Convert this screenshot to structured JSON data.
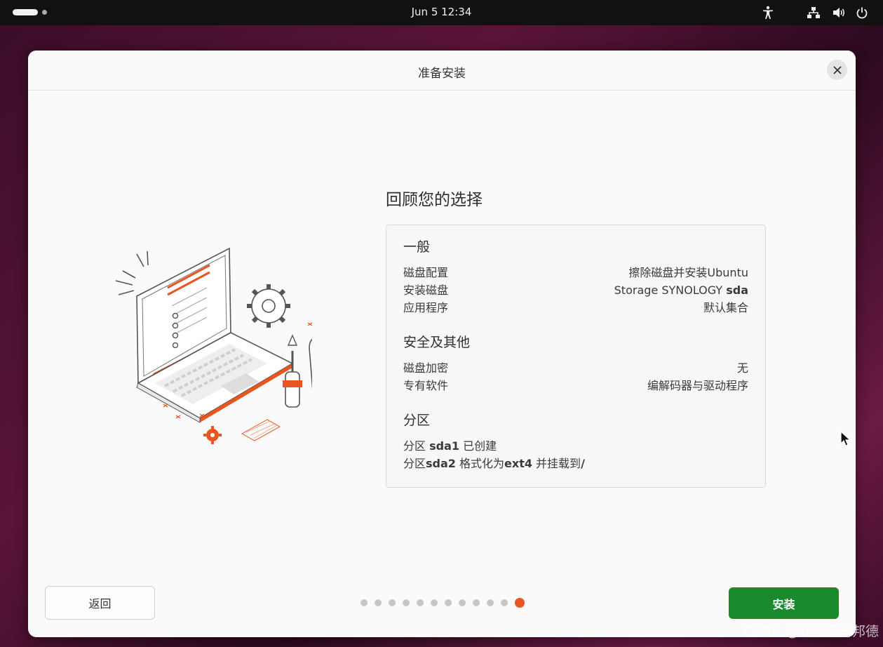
{
  "topbar": {
    "clock": "Jun 5  12:34"
  },
  "dialog": {
    "title": "准备安装",
    "summary_title": "回顾您的选择",
    "general": {
      "title": "一般",
      "rows": [
        {
          "label": "磁盘配置",
          "value": "擦除磁盘并安装Ubuntu"
        },
        {
          "label": "安装磁盘",
          "value_prefix": "Storage SYNOLOGY ",
          "value_bold": "sda"
        },
        {
          "label": "应用程序",
          "value": "默认集合"
        }
      ]
    },
    "security": {
      "title": "安全及其他",
      "rows": [
        {
          "label": "磁盘加密",
          "value": "无"
        },
        {
          "label": "专有软件",
          "value": "编解码器与驱动程序"
        }
      ]
    },
    "partitions": {
      "title": "分区",
      "line1": {
        "a": "分区 ",
        "b": "sda1",
        "c": " 已创建"
      },
      "line2": {
        "a": "分区",
        "b": "sda2",
        "c": " 格式化为",
        "d": "ext4",
        "e": " 并挂载到",
        "f": "/"
      }
    },
    "back_label": "返回",
    "install_label": "安装",
    "progress": {
      "total_steps": 12,
      "current_step": 12
    }
  },
  "watermark": "CSDN @我就是马邦德",
  "colors": {
    "accent": "#e95420",
    "install_button": "#1a8a2e"
  }
}
